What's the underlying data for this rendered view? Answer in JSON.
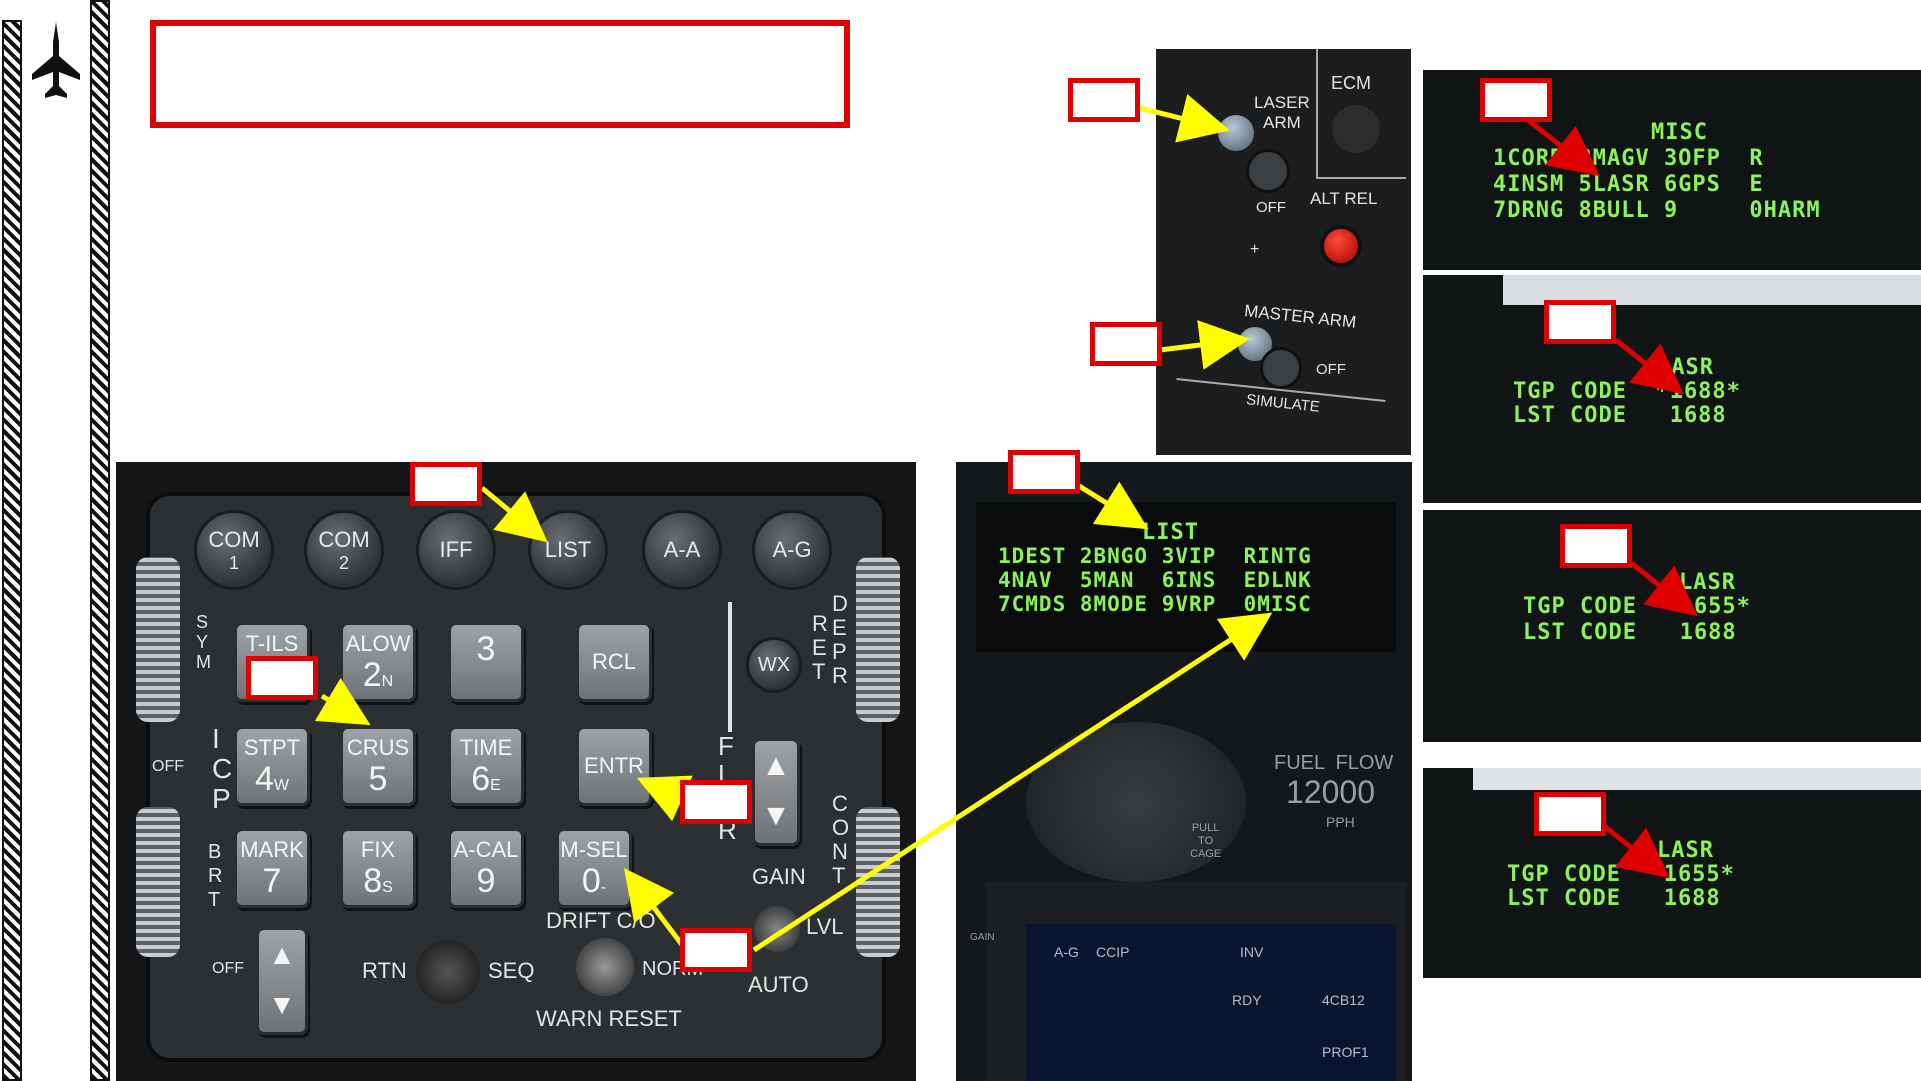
{
  "left_bar": {
    "icon": "fighter-jet-icon"
  },
  "callouts": {
    "title": "",
    "box": ""
  },
  "arm_panel": {
    "laser_arm": "LASER\nARM",
    "ecm": "ECM",
    "off": "OFF",
    "alt_rel": "ALT REL",
    "plus": "+",
    "master_arm": "MASTER ARM",
    "master_off": "OFF",
    "simulate": "SIMULATE"
  },
  "icp": {
    "top_buttons": [
      {
        "top": "COM",
        "bottom": "1"
      },
      {
        "top": "COM",
        "bottom": "2"
      },
      {
        "top": "IFF",
        "bottom": ""
      },
      {
        "top": "LIST",
        "bottom": ""
      },
      {
        "top": "A-A",
        "bottom": ""
      },
      {
        "top": "A-G",
        "bottom": ""
      }
    ],
    "keys": [
      {
        "top": "T-ILS",
        "num": "",
        "sub": ""
      },
      {
        "top": "ALOW",
        "num": "2",
        "sub": "N"
      },
      {
        "top": "",
        "num": "3",
        "sub": ""
      },
      {
        "top": "RCL",
        "num": "",
        "sub": ""
      },
      {
        "top": "STPT",
        "num": "4",
        "sub": "W"
      },
      {
        "top": "CRUS",
        "num": "5",
        "sub": ""
      },
      {
        "top": "TIME",
        "num": "6",
        "sub": "E"
      },
      {
        "top": "ENTR",
        "num": "",
        "sub": ""
      },
      {
        "top": "MARK",
        "num": "7",
        "sub": ""
      },
      {
        "top": "FIX",
        "num": "8",
        "sub": "S"
      },
      {
        "top": "A-CAL",
        "num": "9",
        "sub": ""
      },
      {
        "top": "M-SEL",
        "num": "0",
        "sub": "-"
      }
    ],
    "sym": "S\nY\nM",
    "icp_label": "I\nC\nP",
    "brt": "B\nR\nT",
    "off_upper": "OFF",
    "off_lower": "OFF",
    "wx": "WX",
    "ret": "R\nE\nT",
    "depr": "D\nE\nP\nR",
    "flir": "F\nL\nI\nR",
    "gain": "GAIN",
    "cont": "C\nO\nN\nT",
    "lvl": "LVL",
    "auto": "AUTO",
    "rtn": "RTN",
    "seq": "SEQ",
    "drift": "DRIFT C/O",
    "norm": "NORM",
    "warn_reset": "WARN RESET"
  },
  "ded_list": {
    "title": "LIST",
    "rows": [
      "1DEST 2BNGO 3VIP  RINTG",
      "4NAV  5MAN  6INS  EDLNK",
      "7CMDS 8MODE 9VRP  0MISC"
    ]
  },
  "cockpit_lower": {
    "fuel_flow": "FUEL  FLOW",
    "fuel_value": "12000",
    "pph": "PPH",
    "pull": "PULL\nTO\nCAGE",
    "ag": "A-G",
    "ccip": "CCIP",
    "inv": "INV",
    "rdy": "RDY",
    "code": "4CB12",
    "prof": "PROF1",
    "gain": "GAIN"
  },
  "ded_misc": {
    "title": "MISC",
    "rows": [
      "1CORR 2MAGV 3OFP  R",
      "4INSM 5LASR 6GPS  E",
      "7DRNG 8BULL 9     0HARM"
    ]
  },
  "ded_lasr": [
    {
      "title": "LASR",
      "tgp": "TGP CODE  *1688*",
      "lst": "LST CODE   1688"
    },
    {
      "title": "LASR",
      "tgp": "TGP CODE  *1655*",
      "lst": "LST CODE   1688"
    },
    {
      "title": "LASR",
      "tgp": "TGP CODE  *1655*",
      "lst": "LST CODE   1688"
    }
  ],
  "colors": {
    "arrow": "#ffff00",
    "callout": "#e00000",
    "ded_green": "#8cf25a"
  }
}
